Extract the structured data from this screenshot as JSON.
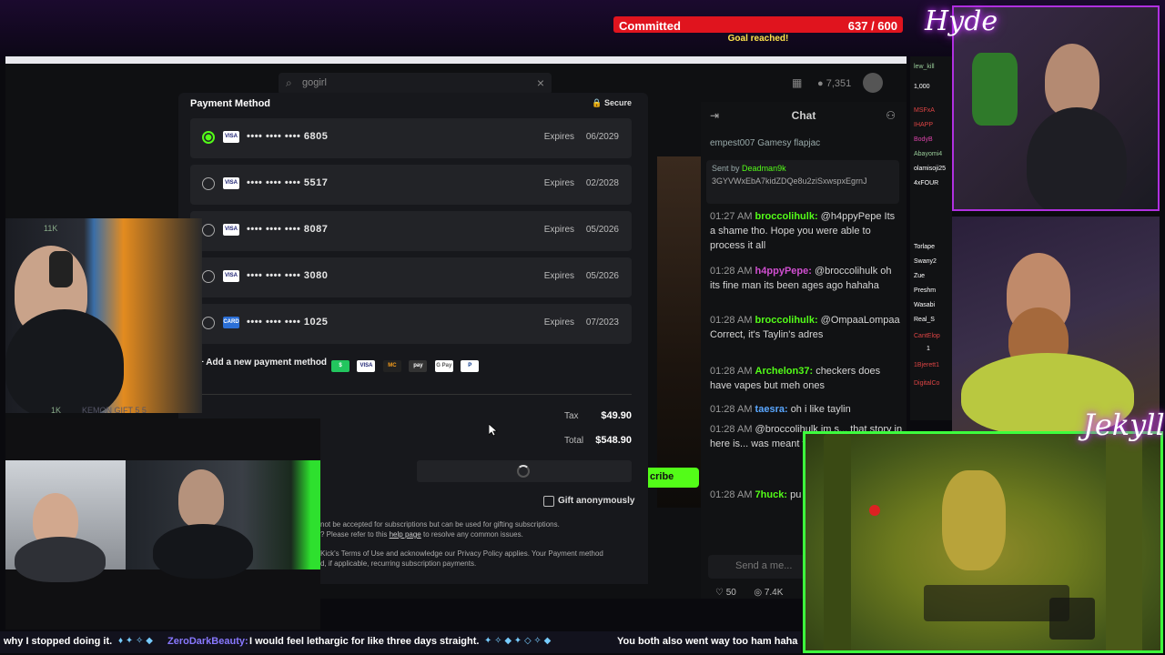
{
  "goal": {
    "label": "Committed",
    "count": "637 / 600",
    "status": "Goal reached!"
  },
  "browser": {
    "search_value": "gogirl",
    "points": "7,351"
  },
  "modal": {
    "title": "Payment Method",
    "secure": "Secure",
    "cards": [
      {
        "brand": "VISA",
        "number": "•••• •••• •••• 6805",
        "expires_label": "Expires",
        "expires": "06/2029",
        "selected": true
      },
      {
        "brand": "VISA",
        "number": "•••• •••• •••• 5517",
        "expires_label": "Expires",
        "expires": "02/2028",
        "selected": false
      },
      {
        "brand": "VISA",
        "number": "•••• •••• •••• 8087",
        "expires_label": "Expires",
        "expires": "05/2026",
        "selected": false
      },
      {
        "brand": "VISA",
        "number": "•••• •••• •••• 3080",
        "expires_label": "Expires",
        "expires": "05/2026",
        "selected": false
      },
      {
        "brand": "CARD",
        "number": "•••• •••• •••• 1025",
        "expires_label": "Expires",
        "expires": "07/2023",
        "selected": false
      }
    ],
    "add_method": "+ Add a new payment method",
    "pay_icons": [
      "$",
      "VISA",
      "MC",
      "pay",
      "G Pay",
      "P"
    ],
    "tax_label": "Tax",
    "tax_value": "$49.90",
    "total_label": "Total",
    "total_value": "$548.90",
    "gift_label": "Gift anonymously",
    "legal_1": "not be accepted for subscriptions but can be used for gifting subscriptions.",
    "legal_2a": "? Please refer to this ",
    "legal_2link": "help page",
    "legal_2b": " to resolve any common issues.",
    "legal_3": "Kick's Terms of Use and acknowledge our Privacy Policy applies. Your Payment method",
    "legal_4": "d, if applicable, recurring subscription payments."
  },
  "chat": {
    "title": "Chat",
    "tabs": "empest007   Gamesy   flapjac",
    "pinned_by": "Sent by",
    "pinned_user": "Deadman9k",
    "pinned_code": "3GYVWxEbA7kidZDQe8u2ziSxwspxEgrnJ",
    "messages": [
      {
        "time": "01:27 AM",
        "user": "broccolihulk:",
        "color": "#53fc18",
        "text": "@h4ppyPepe Its a shame tho. Hope you were able to process it all"
      },
      {
        "time": "01:28 AM",
        "user": "h4ppyPepe:",
        "color": "#d14fd1",
        "text": "@broccolihulk oh its fine man its been ages ago hahaha"
      },
      {
        "time": "01:28 AM",
        "user": "broccolihulk:",
        "color": "#53fc18",
        "text": "@OmpaaLompaa      Correct, it's Taylin's adres"
      },
      {
        "time": "01:28 AM",
        "user": "Archelon37:",
        "color": "#53fc18",
        "text": "checkers does have vapes but meh ones"
      },
      {
        "time": "01:28 AM",
        "user": "taesra:",
        "color": "#5aa7ff",
        "text": "oh i like taylin"
      },
      {
        "time": "01:28 AM",
        "user": "",
        "color": "#53fc18",
        "text": "@broccolihulk im s... that story in here is... was meant to be lik... insertation"
      },
      {
        "time": "01:28 AM",
        "user": "7huck:",
        "color": "#53fc18",
        "text": "pu"
      }
    ],
    "input_placeholder": "Send a me...",
    "stat_a": "50",
    "stat_b": "7.4K",
    "subscribe": "cribe"
  },
  "webcam": {
    "viewers_top": "11K",
    "viewers_bottom": "1K",
    "overlay_left": "KEMON     GIFT 5 5"
  },
  "sidebar": [
    "lew_kill",
    "1,000",
    "MSFxA",
    "IHAPP",
    "BodyB",
    "Abayomi4",
    "olamisoji25",
    "4xFOUR",
    "Torlape",
    "Swany2",
    "Zue",
    "Preshm",
    "Wasabi",
    "Real_S",
    "CantElop",
    "1",
    "1Bjerett1",
    "DigitalCo"
  ],
  "overlay_text": {
    "top_right": "Hyde",
    "bottom_right": "Jekyll"
  },
  "ticker": {
    "a": "why I stopped doing it.",
    "b": "ZeroDarkBeauty:",
    "c": "I would feel lethargic for like three days straight.",
    "d": "You both also went way too ham haha"
  },
  "colors": {
    "kick_green": "#53fc18",
    "goal_red": "#e0141e",
    "frame_purple": "#b030e0",
    "frame_green": "#3dff3d"
  }
}
